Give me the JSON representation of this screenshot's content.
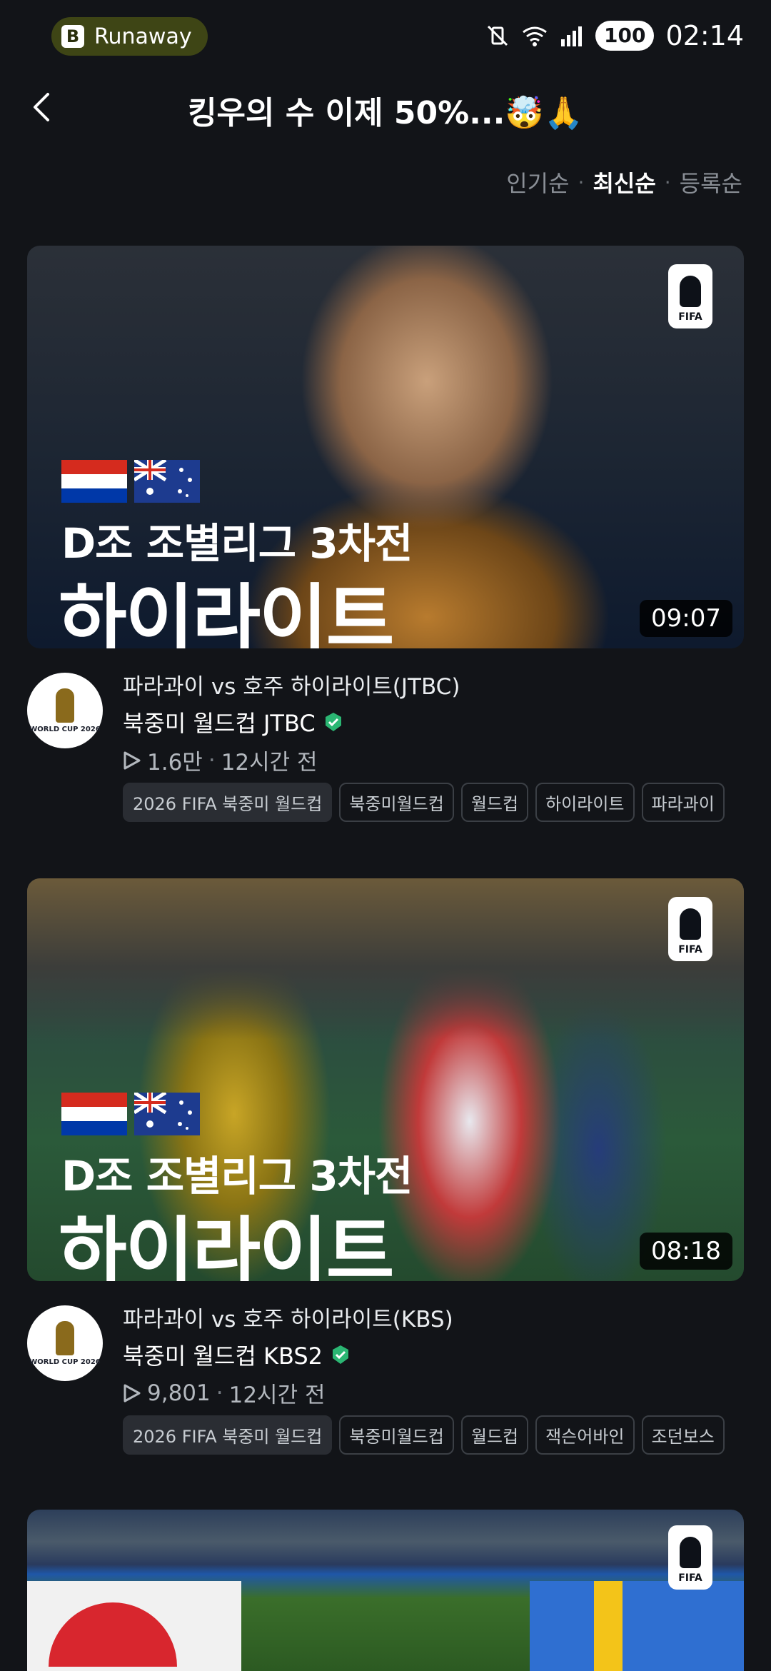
{
  "status_bar": {
    "app_pill": "Runaway",
    "battery": "100",
    "time": "02:14"
  },
  "header": {
    "title": "킹우의 수 이제 50%...🤯🙏"
  },
  "sort": {
    "options": [
      "인기순",
      "최신순",
      "등록순"
    ],
    "active": "최신순",
    "separator": "·"
  },
  "videos": [
    {
      "overlay_sub": "D조 조별리그 3차전",
      "overlay_main": "하이라이트",
      "duration": "09:07",
      "title": "파라과이 vs 호주 하이라이트(JTBC)",
      "channel": "북중미 월드컵 JTBC",
      "views": "1.6만",
      "age": "12시간 전",
      "tags": [
        "2026 FIFA 북중미 월드컵",
        "북중미월드컵",
        "월드컵",
        "하이라이트",
        "파라과이"
      ]
    },
    {
      "overlay_sub": "D조 조별리그 3차전",
      "overlay_main": "하이라이트",
      "duration": "08:18",
      "title": "파라과이 vs 호주 하이라이트(KBS)",
      "channel": "북중미 월드컵 KBS2",
      "views": "9,801",
      "age": "12시간 전",
      "tags": [
        "2026 FIFA 북중미 월드컵",
        "북중미월드컵",
        "월드컵",
        "잭슨어바인",
        "조던보스"
      ]
    }
  ],
  "badge_text": "FIFA",
  "avatar_text": "WORLD CUP 2026",
  "colors": {
    "background": "#121418",
    "verified": "#2bb673",
    "pill": "#3e4515"
  }
}
